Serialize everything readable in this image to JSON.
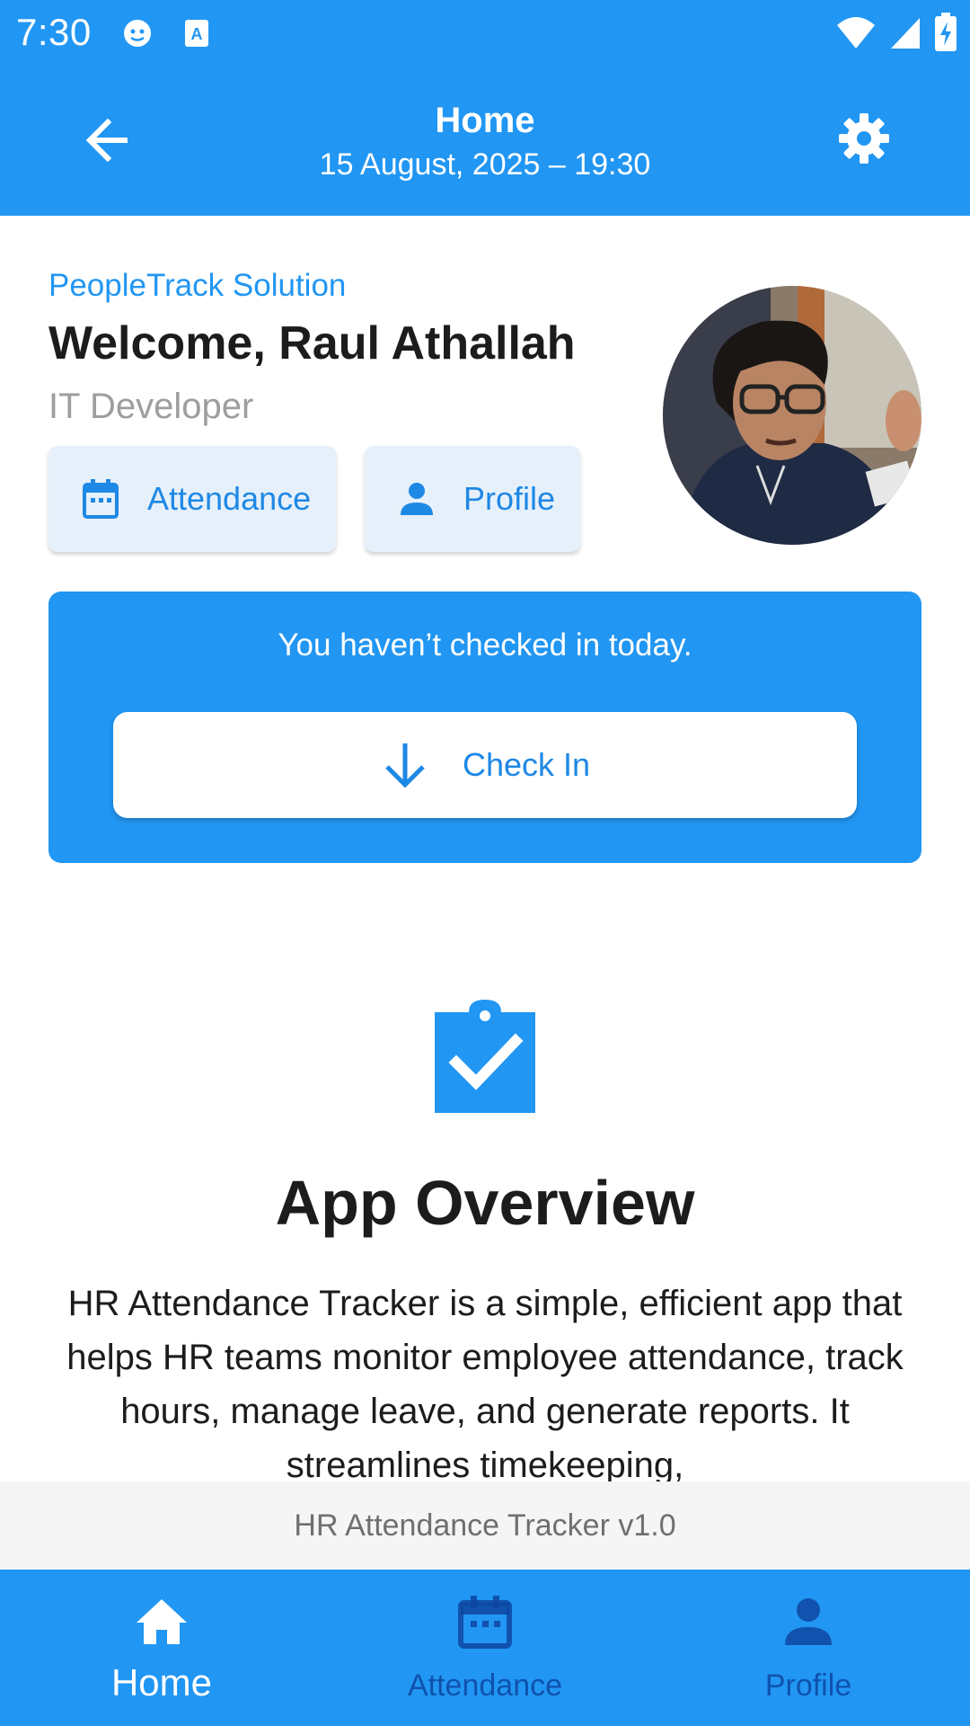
{
  "status_bar": {
    "time": "7:30",
    "icons_left": [
      "notification-face-icon",
      "text-recognition-icon"
    ],
    "icons_right": [
      "wifi-icon",
      "signal-icon",
      "battery-charging-icon"
    ]
  },
  "app_bar": {
    "title": "Home",
    "subtitle": "15 August, 2025 – 19:30",
    "back_icon": "arrow-back-icon",
    "settings_icon": "gear-icon"
  },
  "header": {
    "company": "PeopleTrack Solution",
    "welcome": "Welcome, Raul Athallah",
    "role": "IT Developer",
    "avatar": "user-avatar-photo"
  },
  "quick_actions": {
    "attendance_label": "Attendance",
    "profile_label": "Profile"
  },
  "checkin": {
    "message": "You haven’t checked in today.",
    "button_label": "Check In"
  },
  "overview": {
    "title": "App Overview",
    "text": "HR Attendance Tracker is a simple, efficient app that helps HR teams monitor employee attendance, track hours, manage leave, and generate reports. It streamlines timekeeping,"
  },
  "footer": {
    "version": "HR Attendance Tracker v1.0"
  },
  "bottom_nav": {
    "items": [
      {
        "label": "Home",
        "icon": "home-icon",
        "active": true
      },
      {
        "label": "Attendance",
        "icon": "calendar-icon",
        "active": false
      },
      {
        "label": "Profile",
        "icon": "person-icon",
        "active": false
      }
    ]
  },
  "colors": {
    "primary": "#2196F3",
    "accent_text": "#1E88E5",
    "chip_bg": "#E6F0FB",
    "inactive_nav": "#0D47A1",
    "muted_text": "#9E9E9E"
  }
}
